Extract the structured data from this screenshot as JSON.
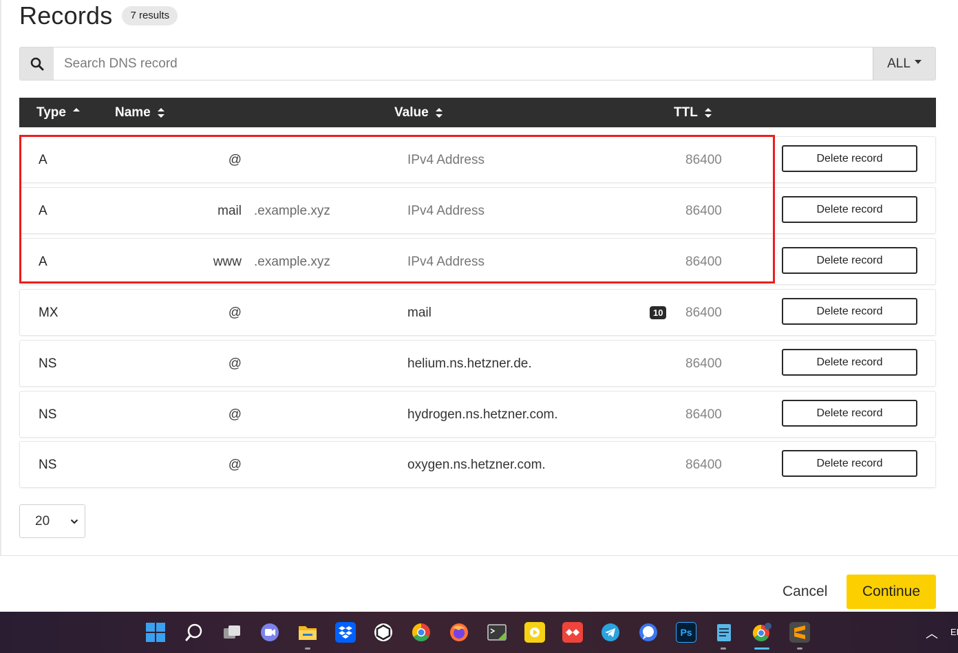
{
  "header": {
    "title": "Records",
    "count_badge": "7 results"
  },
  "search": {
    "placeholder": "Search DNS record",
    "filter_label": "ALL"
  },
  "table": {
    "columns": [
      {
        "label": "Type",
        "sort": "ascending"
      },
      {
        "label": "Name",
        "sort": "none"
      },
      {
        "label": "Value",
        "sort": "none"
      },
      {
        "label": "TTL",
        "sort": "none"
      }
    ],
    "rows": [
      {
        "type": "A",
        "name": "@",
        "suffix": "",
        "value": "IPv4 Address",
        "value_style": "placeholder",
        "priority": "",
        "ttl": "86400",
        "action": "Delete record"
      },
      {
        "type": "A",
        "name": "mail",
        "suffix": ".example.xyz",
        "value": "IPv4 Address",
        "value_style": "placeholder",
        "priority": "",
        "ttl": "86400",
        "action": "Delete record"
      },
      {
        "type": "A",
        "name": "www",
        "suffix": ".example.xyz",
        "value": "IPv4 Address",
        "value_style": "placeholder",
        "priority": "",
        "ttl": "86400",
        "action": "Delete record"
      },
      {
        "type": "MX",
        "name": "@",
        "suffix": "",
        "value": "mail",
        "value_style": "filled",
        "priority": "10",
        "ttl": "86400",
        "action": "Delete record"
      },
      {
        "type": "NS",
        "name": "@",
        "suffix": "",
        "value": "helium.ns.hetzner.de.",
        "value_style": "filled",
        "priority": "",
        "ttl": "86400",
        "action": "Delete record"
      },
      {
        "type": "NS",
        "name": "@",
        "suffix": "",
        "value": "hydrogen.ns.hetzner.com.",
        "value_style": "filled",
        "priority": "",
        "ttl": "86400",
        "action": "Delete record"
      },
      {
        "type": "NS",
        "name": "@",
        "suffix": "",
        "value": "oxygen.ns.hetzner.com.",
        "value_style": "filled",
        "priority": "",
        "ttl": "86400",
        "action": "Delete record"
      }
    ]
  },
  "pagination": {
    "per_page": "20"
  },
  "footer": {
    "cancel_label": "Cancel",
    "continue_label": "Continue"
  },
  "taskbar": {
    "icons": [
      "windows-start-icon",
      "search-icon",
      "task-view-icon",
      "teams-chat-icon",
      "file-explorer-icon",
      "dropbox-icon",
      "unity-hub-icon",
      "chrome-icon",
      "firefox-icon",
      "snipping-tool-icon",
      "potplayer-icon",
      "anydesk-icon",
      "telegram-icon",
      "signal-icon",
      "photoshop-icon",
      "notepad-icon",
      "chrome-profile-icon",
      "sublime-text-icon"
    ],
    "photoshop_label": "Ps",
    "tray_text": "EI"
  },
  "colors": {
    "accent_yellow": "#fcd000",
    "header_dark": "#2f2f2f",
    "highlight_red": "#ef1c1c"
  }
}
